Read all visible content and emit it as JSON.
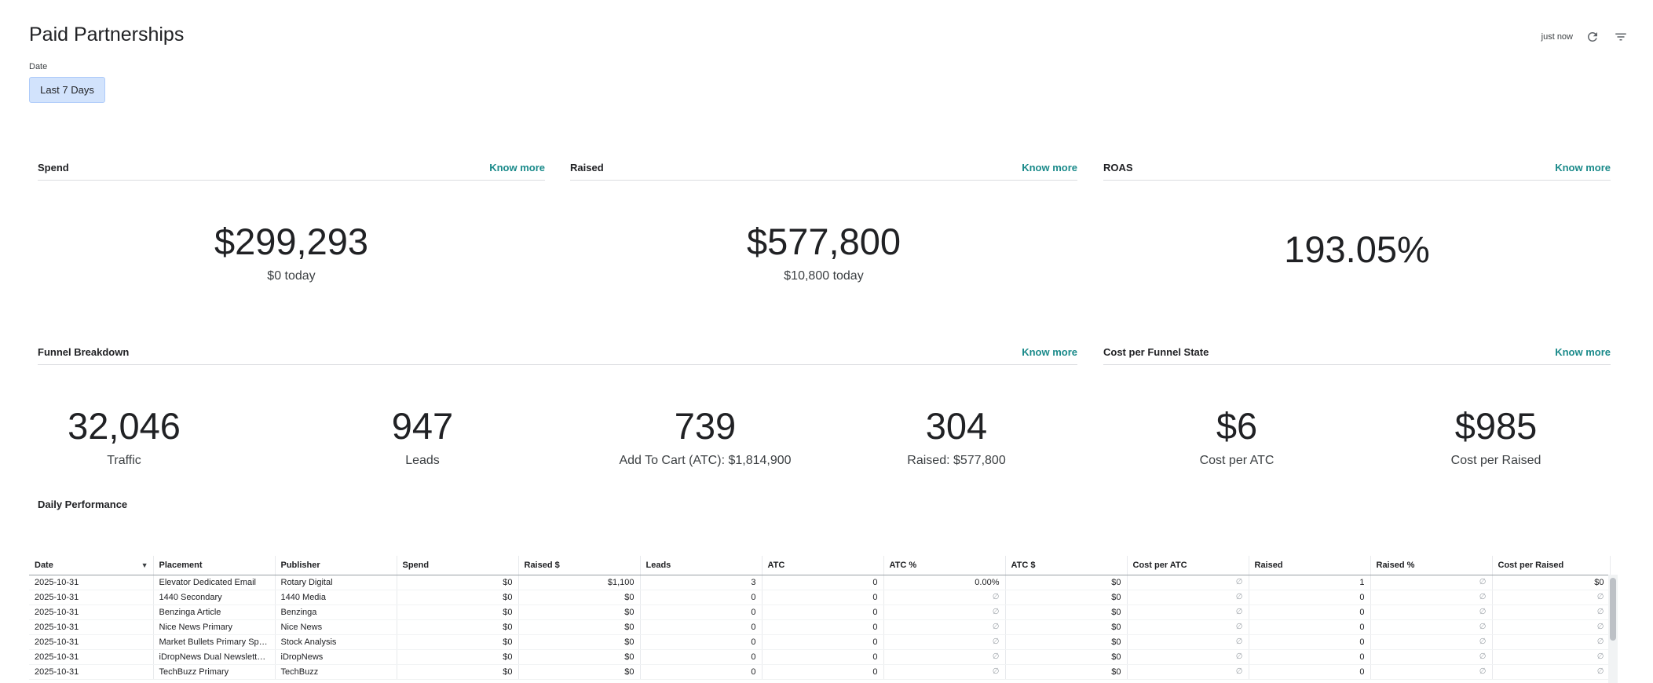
{
  "page": {
    "title": "Paid Partnerships",
    "updated": "just now"
  },
  "filters": {
    "date_label": "Date",
    "date_value": "Last 7 Days"
  },
  "cards": {
    "spend": {
      "title": "Spend",
      "know_more": "Know more",
      "value": "$299,293",
      "sub": "$0 today"
    },
    "raised": {
      "title": "Raised",
      "know_more": "Know more",
      "value": "$577,800",
      "sub": "$10,800 today"
    },
    "roas": {
      "title": "ROAS",
      "know_more": "Know more",
      "value": "193.05%"
    },
    "funnel": {
      "title": "Funnel Breakdown",
      "know_more": "Know more",
      "metrics": [
        {
          "value": "32,046",
          "label": "Traffic"
        },
        {
          "value": "947",
          "label": "Leads"
        },
        {
          "value": "739",
          "label": "Add To Cart (ATC): $1,814,900"
        },
        {
          "value": "304",
          "label": "Raised: $577,800"
        }
      ]
    },
    "cost_funnel": {
      "title": "Cost per Funnel State",
      "know_more": "Know more",
      "metrics": [
        {
          "value": "$6",
          "label": "Cost per ATC"
        },
        {
          "value": "$985",
          "label": "Cost per Raised"
        }
      ]
    },
    "daily": {
      "title": "Daily Performance"
    }
  },
  "table": {
    "columns": [
      "Date",
      "Placement",
      "Publisher",
      "Spend",
      "Raised $",
      "Leads",
      "ATC",
      "ATC %",
      "ATC $",
      "Cost per ATC",
      "Raised",
      "Raised %",
      "Cost per Raised"
    ],
    "null_symbol": "∅",
    "rows": [
      [
        "2025-10-31",
        "Elevator Dedicated Email",
        "Rotary Digital",
        "$0",
        "$1,100",
        "3",
        "0",
        "0.00%",
        "$0",
        "∅",
        "1",
        "∅",
        "$0"
      ],
      [
        "2025-10-31",
        "1440 Secondary",
        "1440 Media",
        "$0",
        "$0",
        "0",
        "0",
        "∅",
        "$0",
        "∅",
        "0",
        "∅",
        "∅"
      ],
      [
        "2025-10-31",
        "Benzinga Article",
        "Benzinga",
        "$0",
        "$0",
        "0",
        "0",
        "∅",
        "$0",
        "∅",
        "0",
        "∅",
        "∅"
      ],
      [
        "2025-10-31",
        "Nice News Primary",
        "Nice News",
        "$0",
        "$0",
        "0",
        "0",
        "∅",
        "$0",
        "∅",
        "0",
        "∅",
        "∅"
      ],
      [
        "2025-10-31",
        "Market Bullets Primary Sponsor",
        "Stock Analysis",
        "$0",
        "$0",
        "0",
        "0",
        "∅",
        "$0",
        "∅",
        "0",
        "∅",
        "∅"
      ],
      [
        "2025-10-31",
        "iDropNews Dual Newsletter Sponsor",
        "iDropNews",
        "$0",
        "$0",
        "0",
        "0",
        "∅",
        "$0",
        "∅",
        "0",
        "∅",
        "∅"
      ],
      [
        "2025-10-31",
        "TechBuzz Primary",
        "TechBuzz",
        "$0",
        "$0",
        "0",
        "0",
        "∅",
        "$0",
        "∅",
        "0",
        "∅",
        "∅"
      ]
    ]
  }
}
